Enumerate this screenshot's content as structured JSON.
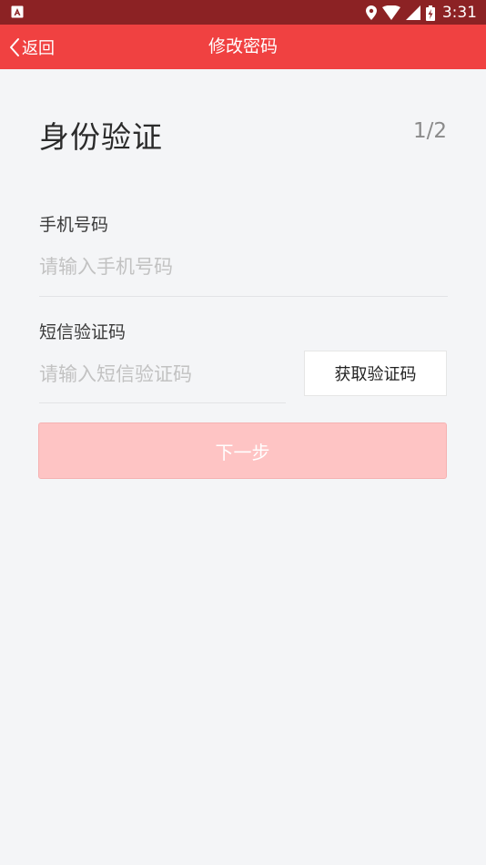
{
  "status_bar": {
    "time": "3:31",
    "icons": [
      "notification-icon",
      "location-icon",
      "wifi-icon",
      "signal-icon",
      "battery-icon"
    ]
  },
  "nav": {
    "back_label": "返回",
    "title": "修改密码"
  },
  "main": {
    "page_title": "身份验证",
    "step": "1/2",
    "phone": {
      "label": "手机号码",
      "value": "",
      "placeholder": "请输入手机号码"
    },
    "sms": {
      "label": "短信验证码",
      "value": "",
      "placeholder": "请输入短信验证码",
      "get_code_label": "获取验证码"
    },
    "next_label": "下一步"
  },
  "colors": {
    "status_bar": "#8c2224",
    "nav_bar": "#f04141",
    "background": "#f4f5f7",
    "next_button_disabled": "#fec4c4"
  }
}
